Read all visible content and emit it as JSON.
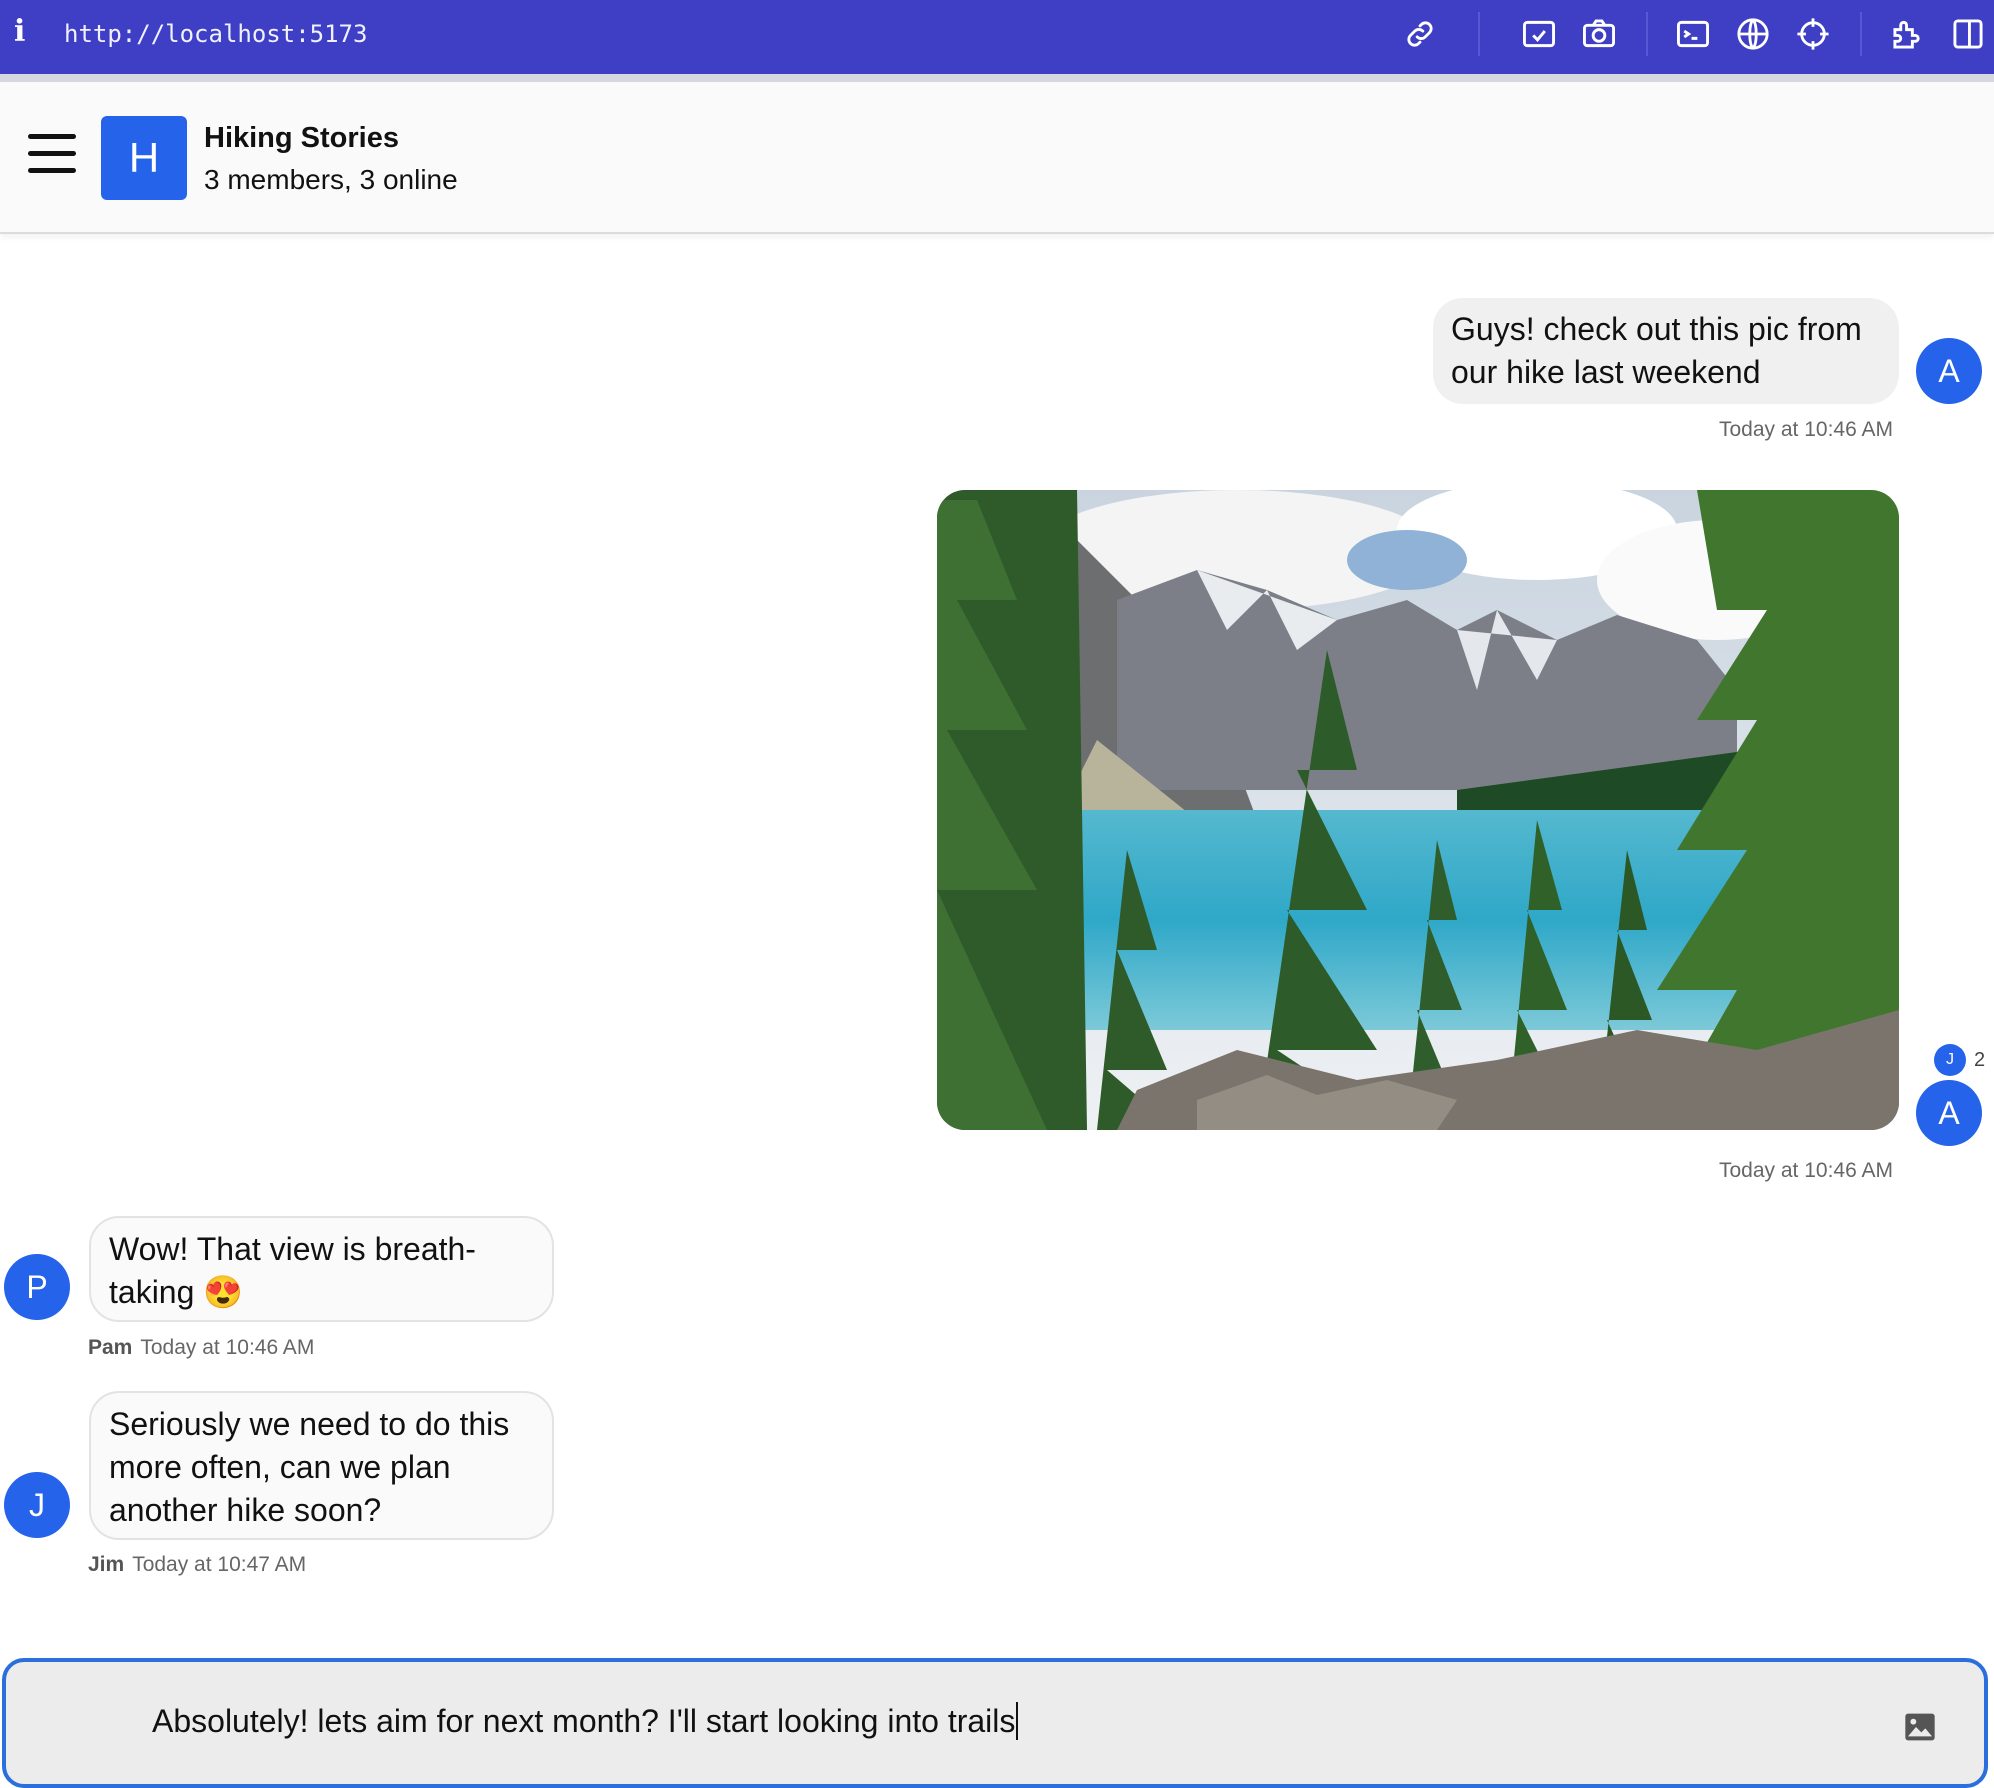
{
  "browser": {
    "info_glyph": "i",
    "url": "http://localhost:5173",
    "icons": [
      "link-icon",
      "screenshot-icon",
      "camera-icon",
      "terminal-icon",
      "globe-icon",
      "crosshair-icon",
      "extensions-icon",
      "sidebar-icon"
    ]
  },
  "header": {
    "avatar_letter": "H",
    "title": "Hiking Stories",
    "subtitle": "3 members, 3 online"
  },
  "messages": {
    "m1": {
      "text": "Guys! check out this pic from our hike last weekend",
      "avatar": "A",
      "time": "Today at 10:46 AM"
    },
    "m2": {
      "avatar": "A",
      "time": "Today at 10:46 AM",
      "read_by_avatar": "J",
      "read_count": "2"
    },
    "m3": {
      "text": "Wow! That view is breath-taking 😍",
      "avatar": "P",
      "sender": "Pam",
      "time": "Today at 10:46 AM"
    },
    "m4": {
      "text": "Seriously we need to do this more often, can we plan another hike soon?",
      "avatar": "J",
      "sender": "Jim",
      "time": "Today at 10:47 AM"
    }
  },
  "composer": {
    "value": "Absolutely! lets aim for next month? I'll start looking into trails"
  },
  "colors": {
    "accent": "#2563eb",
    "browser_bar": "#3f3fc5",
    "composer_border": "#2b6fdc"
  }
}
